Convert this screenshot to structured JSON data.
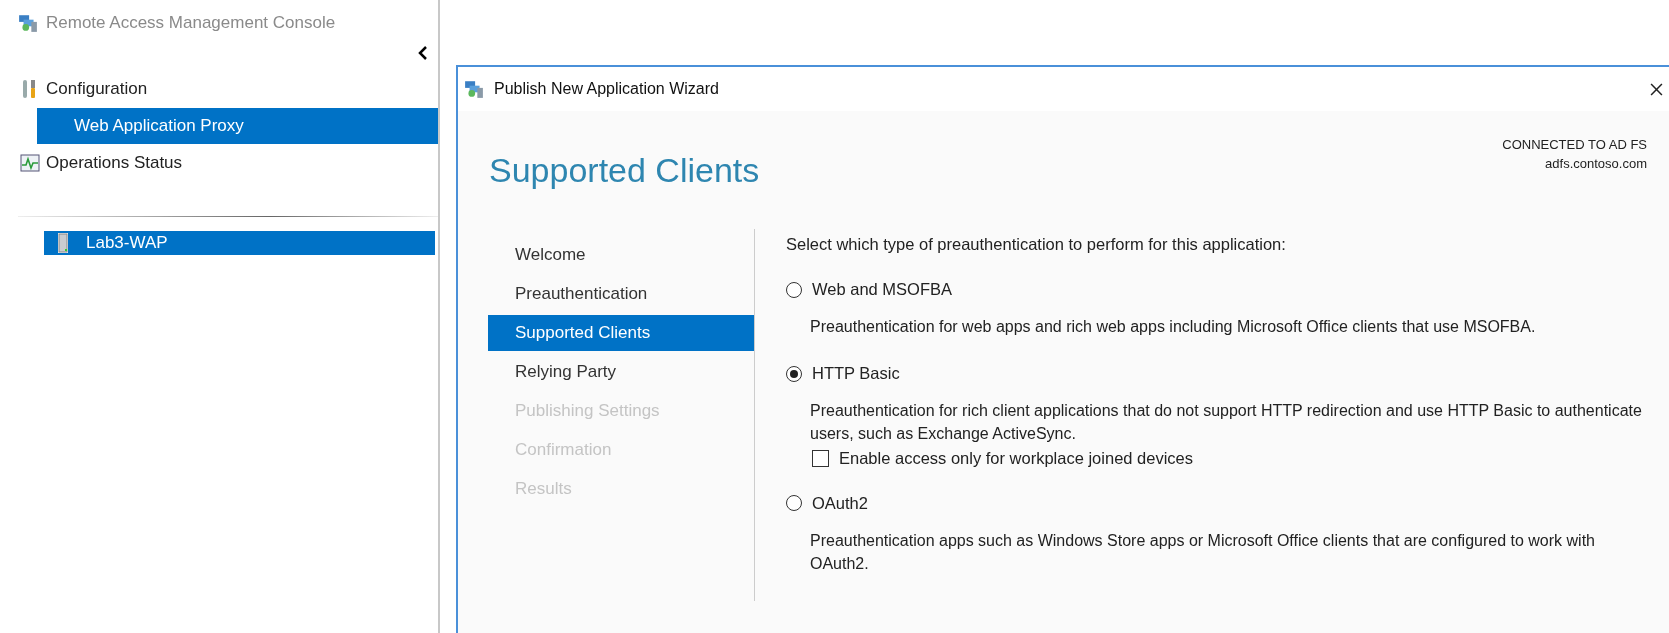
{
  "app": {
    "title": "Remote Access Management Console"
  },
  "sidebar": {
    "items": [
      {
        "label": "Configuration",
        "kind": "tools",
        "selected": false,
        "children": [
          {
            "label": "Web Application Proxy",
            "selected": true
          }
        ]
      },
      {
        "label": "Operations Status",
        "kind": "chart",
        "selected": false
      }
    ],
    "servers": [
      {
        "label": "Lab3-WAP",
        "selected": true
      }
    ]
  },
  "wizard": {
    "title": "Publish New Application Wizard",
    "heading": "Supported Clients",
    "connection": {
      "label": "CONNECTED TO AD FS",
      "server": "adfs.contoso.com"
    },
    "steps": [
      {
        "label": "Welcome",
        "selected": false,
        "disabled": false
      },
      {
        "label": "Preauthentication",
        "selected": false,
        "disabled": false
      },
      {
        "label": "Supported Clients",
        "selected": true,
        "disabled": false
      },
      {
        "label": "Relying Party",
        "selected": false,
        "disabled": false
      },
      {
        "label": "Publishing Settings",
        "selected": false,
        "disabled": true
      },
      {
        "label": "Confirmation",
        "selected": false,
        "disabled": true
      },
      {
        "label": "Results",
        "selected": false,
        "disabled": true
      }
    ],
    "prompt": "Select which type of preauthentication to perform for this application:",
    "options": [
      {
        "label": "Web and MSOFBA",
        "selected": false,
        "description": "Preauthentication for web apps and rich web apps including Microsoft Office clients that use MSOFBA."
      },
      {
        "label": "HTTP Basic",
        "selected": true,
        "description": "Preauthentication for rich client applications that do not support HTTP redirection and use HTTP Basic to authenticate users, such as Exchange ActiveSync.",
        "checkboxes": [
          {
            "label": "Enable access only for workplace joined devices",
            "checked": false
          }
        ]
      },
      {
        "label": "OAuth2",
        "selected": false,
        "description": "Preauthentication apps such as Windows Store apps or Microsoft Office clients that are configured to work with OAuth2."
      }
    ]
  }
}
